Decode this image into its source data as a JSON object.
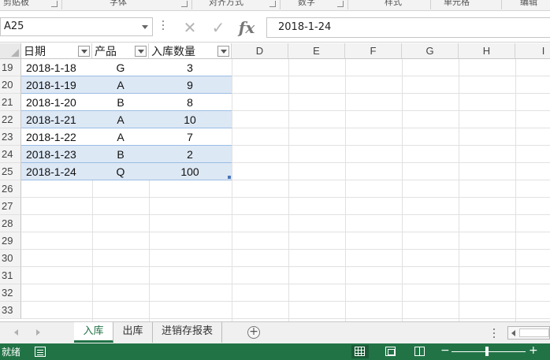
{
  "ribbon": {
    "groups": [
      "剪贴板",
      "字体",
      "对齐方式",
      "数字",
      "样式",
      "单元格",
      "编辑"
    ]
  },
  "formula_bar": {
    "name_box": "A25",
    "formula": "2018-1-24",
    "fx_label": "fx"
  },
  "columns": [
    "D",
    "E",
    "F",
    "G",
    "H",
    "I"
  ],
  "table": {
    "headers": [
      "日期",
      "产品",
      "入库数量"
    ],
    "rows": [
      {
        "row": "19",
        "date": "2018-1-18",
        "product": "G",
        "qty": "3"
      },
      {
        "row": "20",
        "date": "2018-1-19",
        "product": "A",
        "qty": "9"
      },
      {
        "row": "21",
        "date": "2018-1-20",
        "product": "B",
        "qty": "8"
      },
      {
        "row": "22",
        "date": "2018-1-21",
        "product": "A",
        "qty": "10"
      },
      {
        "row": "23",
        "date": "2018-1-22",
        "product": "A",
        "qty": "7"
      },
      {
        "row": "24",
        "date": "2018-1-23",
        "product": "B",
        "qty": "2"
      },
      {
        "row": "25",
        "date": "2018-1-24",
        "product": "Q",
        "qty": "100"
      }
    ]
  },
  "empty_rows": [
    "26",
    "27",
    "28",
    "29",
    "30",
    "31",
    "32",
    "33"
  ],
  "sheets": {
    "tabs": [
      "入库",
      "出库",
      "进销存报表"
    ],
    "active": "入库"
  },
  "status": {
    "text": "就绪"
  },
  "colors": {
    "accent": "#217346",
    "band": "#dde8f5",
    "table_border": "#9bbde3"
  }
}
